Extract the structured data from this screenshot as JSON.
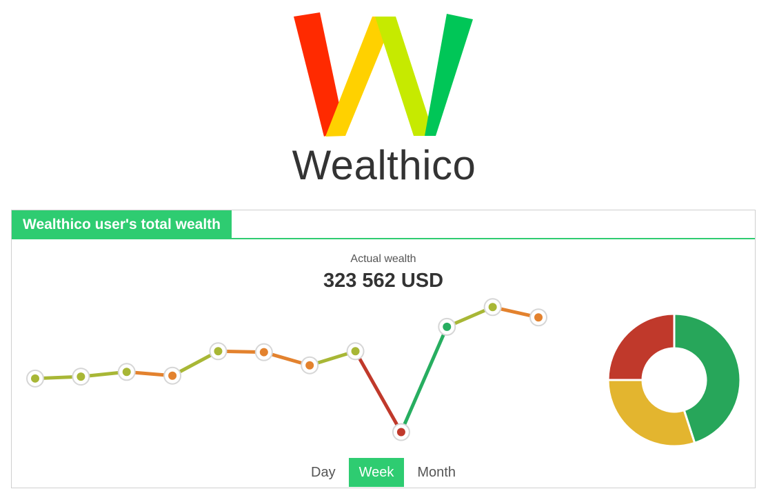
{
  "brand": {
    "name": "Wealthico",
    "logo_colors": [
      "#ff2a00",
      "#ffd100",
      "#c6ea00",
      "#00c657"
    ]
  },
  "panel": {
    "title": "Wealthico user's total wealth",
    "accent_color": "#2ecc71",
    "wealth_label": "Actual wealth",
    "wealth_value": "323 562 USD"
  },
  "range_tabs": [
    {
      "label": "Day",
      "active": false
    },
    {
      "label": "Week",
      "active": true
    },
    {
      "label": "Month",
      "active": false
    }
  ],
  "chart_data": [
    {
      "type": "line",
      "x": [
        1,
        2,
        3,
        4,
        5,
        6,
        7,
        8,
        9,
        10,
        11,
        12
      ],
      "series": [
        {
          "values": [
            235,
            237,
            242,
            238,
            264,
            263,
            249,
            264,
            178,
            290,
            311,
            300
          ],
          "point_colors": [
            "#a8b736",
            "#a8b736",
            "#a8b736",
            "#e3822e",
            "#a8b736",
            "#e3822e",
            "#e3822e",
            "#a8b736",
            "#c0392b",
            "#27ae60",
            "#a8b736",
            "#e3822e"
          ],
          "segment_colors": [
            "#a8b736",
            "#a8b736",
            "#e3822e",
            "#a8b736",
            "#e3822e",
            "#e3822e",
            "#a8b736",
            "#c0392b",
            "#27ae60",
            "#a8b736",
            "#e3822e"
          ]
        }
      ],
      "ylim": [
        160,
        320
      ],
      "grid": false,
      "legend": "none"
    },
    {
      "type": "pie",
      "variant": "donut",
      "values": [
        45,
        30,
        25
      ],
      "colors": [
        "#27a65a",
        "#e3b52f",
        "#c0392b"
      ]
    }
  ]
}
